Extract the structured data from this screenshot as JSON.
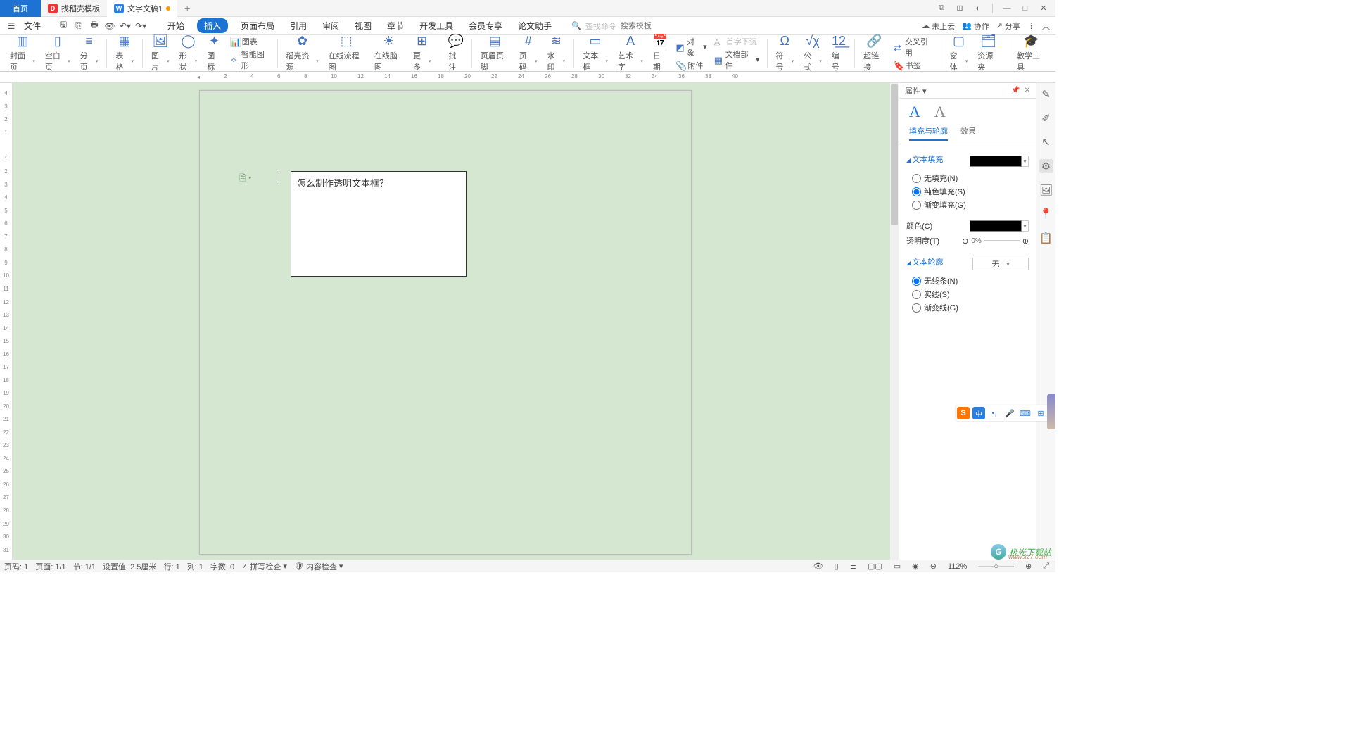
{
  "tabs": {
    "home": "首页",
    "t1": "找稻壳模板",
    "t2": "文字文稿1"
  },
  "menu": {
    "file": "文件",
    "items": [
      "开始",
      "插入",
      "页面布局",
      "引用",
      "审阅",
      "视图",
      "章节",
      "开发工具",
      "会员专享",
      "论文助手"
    ],
    "active": "插入"
  },
  "search": {
    "placeholder_cmd": "查找命令",
    "placeholder_tpl": "搜索模板"
  },
  "topright": {
    "cloud": "未上云",
    "collab": "协作",
    "share": "分享"
  },
  "ribbon": {
    "cover": "封面页",
    "blank": "空白页",
    "section": "分页",
    "table": "表格",
    "pic": "图片",
    "shape": "形状",
    "icon": "图标",
    "chart": "图表",
    "smartart": "智能图形",
    "dkres": "稻壳资源",
    "flow": "在线流程图",
    "mind": "在线脑图",
    "more": "更多",
    "comment": "批注",
    "header": "页眉页脚",
    "pageno": "页码",
    "watermark": "水印",
    "txtbox": "文本框",
    "wordart": "艺术字",
    "date": "日期",
    "object": "对象",
    "dropcap": "首字下沉",
    "attach": "附件",
    "docpart": "文档部件",
    "symbol": "符号",
    "formula": "公式",
    "numbering": "编号",
    "link": "超链接",
    "bookmark": "书签",
    "xref": "交叉引用",
    "window": "窗体",
    "resgrp": "资源夹",
    "teach": "教学工具"
  },
  "textbox_content": "怎么制作透明文本框？",
  "panel": {
    "title": "属性",
    "tab_a": "A",
    "tab_b": "A",
    "sub1": "填充与轮廓",
    "sub2": "效果",
    "sec_fill": "文本填充",
    "fill_none": "无填充(N)",
    "fill_solid": "纯色填充(S)",
    "fill_grad": "渐变填充(G)",
    "color": "颜色(C)",
    "opacity": "透明度(T)",
    "opacity_val": "0%",
    "sec_outline": "文本轮廓",
    "outline_val": "无",
    "ol_none": "无线条(N)",
    "ol_solid": "实线(S)",
    "ol_grad": "渐变线(G)"
  },
  "status": {
    "pageno": "页码: 1",
    "page": "页面: 1/1",
    "sec": "节: 1/1",
    "pos": "设置值: 2.5厘米",
    "line": "行: 1",
    "col": "列: 1",
    "chars": "字数: 0",
    "spell": "拼写检查",
    "content": "内容检查",
    "zoom": "112%"
  },
  "watermark": {
    "name": "极光下载站",
    "sub": "www.xz7.com"
  }
}
